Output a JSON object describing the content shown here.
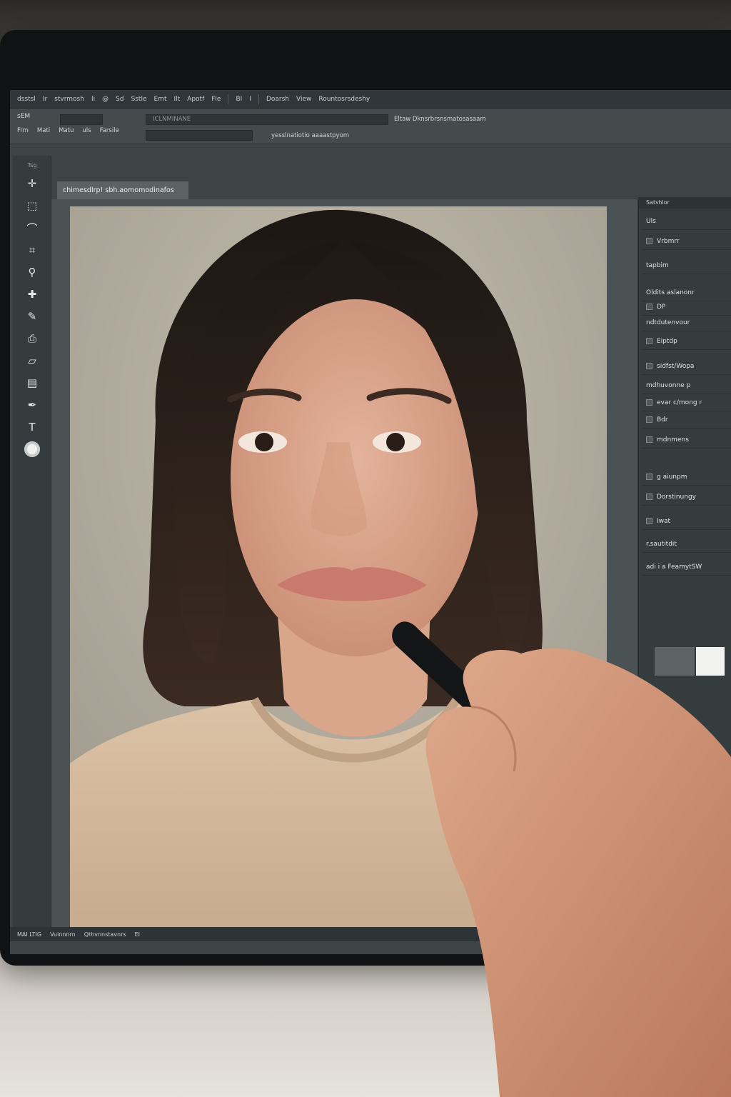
{
  "menubar": {
    "items": [
      "dsstsl",
      "Ir",
      "stvrmosh",
      "Ii",
      "@",
      "Sd",
      "Sstle",
      "Emt",
      "Ilt",
      "Apotf",
      "Fle",
      "BI",
      "I",
      "Doarsh",
      "View",
      "Rountosrsdeshy"
    ]
  },
  "options": {
    "label_left": "sEM",
    "tabs": [
      "Frm",
      "Mati",
      "Matu",
      "uls",
      "Farsile"
    ],
    "field_text": "Eltaw Dknsrbrsnsmatosasaam",
    "field_text_2": "yesslnatiotio aaaastpyom",
    "ghost_text": "ICLNMINANE"
  },
  "toolbar": {
    "header": "Tsg",
    "tools": [
      {
        "name": "move-tool-icon",
        "glyph": "✛"
      },
      {
        "name": "marquee-tool-icon",
        "glyph": "⬚"
      },
      {
        "name": "lasso-tool-icon",
        "glyph": "⌒"
      },
      {
        "name": "crop-tool-icon",
        "glyph": "⌗"
      },
      {
        "name": "eyedropper-tool-icon",
        "glyph": "⚲"
      },
      {
        "name": "healing-tool-icon",
        "glyph": "✚"
      },
      {
        "name": "brush-tool-icon",
        "glyph": "✎"
      },
      {
        "name": "stamp-tool-icon",
        "glyph": "⎙"
      },
      {
        "name": "eraser-tool-icon",
        "glyph": "▱"
      },
      {
        "name": "gradient-tool-icon",
        "glyph": "▤"
      },
      {
        "name": "pen-tool-icon",
        "glyph": "✒"
      },
      {
        "name": "text-tool-icon",
        "glyph": "T"
      }
    ]
  },
  "document": {
    "tab_title": "chimesdlrp! sbh.aomomodinafos"
  },
  "panel": {
    "header": "Satshlor",
    "rows": [
      {
        "label": "Uls",
        "checkbox": false
      },
      {
        "label": "Vrbmrr",
        "checkbox": true
      },
      {
        "label": "tapbim",
        "checkbox": false
      },
      {
        "label": "Oldits aslanonr",
        "checkbox": false
      },
      {
        "label": "DP",
        "checkbox": true
      },
      {
        "label": "ndtdutenvour",
        "checkbox": false
      },
      {
        "label": "Eiptdp",
        "checkbox": true
      },
      {
        "label": "sidfst/Wopa",
        "checkbox": true
      },
      {
        "label": "mdhuvonne p",
        "checkbox": false
      },
      {
        "label": "evar c/mong r",
        "checkbox": true
      },
      {
        "label": "Bdr",
        "checkbox": true
      },
      {
        "label": "mdnmens",
        "checkbox": true
      },
      {
        "label": "g aiunpm",
        "checkbox": true
      },
      {
        "label": "Dorstinungy",
        "checkbox": true
      },
      {
        "label": "Iwat",
        "checkbox": true
      },
      {
        "label": "r.sautitdit",
        "checkbox": false
      },
      {
        "label": "adi i a FeamytSW",
        "checkbox": false
      }
    ]
  },
  "statusbar": {
    "items": [
      "MAI LTIG",
      "Vuinnnrn",
      "Qthvnnstavnrs",
      "EI"
    ]
  },
  "colors": {
    "ui_dark": "#30363a",
    "ui_mid": "#3d4446",
    "canvas_bg": "#b9b3a7",
    "skin": "#d9a58d",
    "hair": "#2a1f1a",
    "sweater": "#d5b99e"
  }
}
